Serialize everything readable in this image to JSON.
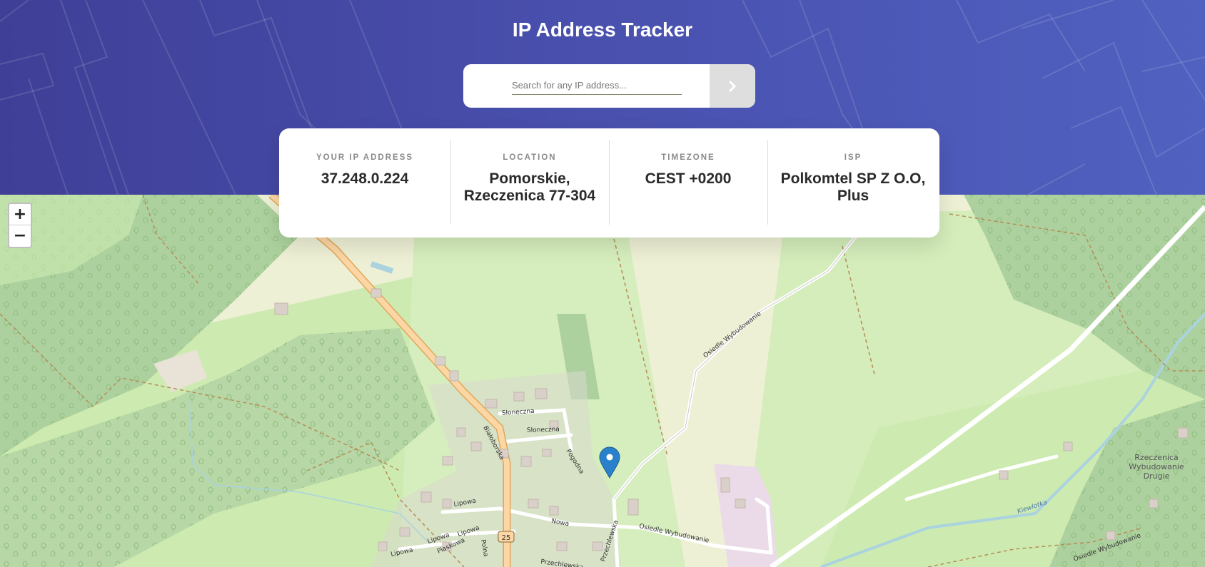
{
  "header": {
    "title": "IP Address Tracker"
  },
  "search": {
    "placeholder": "Search for any IP address...",
    "value": ""
  },
  "info": [
    {
      "label": "YOUR IP ADDRESS",
      "value": "37.248.0.224"
    },
    {
      "label": "LOCATION",
      "value": "Pomorskie,\nRzeczenica 77-304"
    },
    {
      "label": "TIMEZONE",
      "value": "CEST +0200"
    },
    {
      "label": "ISP",
      "value": "Polkomtel SP Z O.O,\nPlus"
    }
  ],
  "map": {
    "zoom_in": "+",
    "zoom_out": "−",
    "labels": {
      "slonecza1": "Słoneczna",
      "slonecza2": "Słoneczna",
      "bialoborska": "Białoborska",
      "pogodna": "Pogodna",
      "lipowa1": "Lipowa",
      "lipowa2": "Lipowa",
      "lipowa3": "Lipowa",
      "lipowa4": "Lipowa",
      "piaskowa": "Piaskowa",
      "polna": "Polna",
      "nowa": "Nowa",
      "osiedle1": "Osiedle Wybudowanie",
      "osiedle2": "Osiedle Wybudowanie",
      "osiedle3": "Osiedle Wybudowanie",
      "przechlewska1": "Przechlewska",
      "przechlewska2": "Przechlewska",
      "kiewlotka": "Kiewlotka",
      "rzeczenica1": "Rzeczenica",
      "rzeczenica2": "Wybudowanie",
      "rzeczenica3": "Drugie",
      "road_number": "25"
    }
  },
  "colors": {
    "header_gradient_start": "#3f3f97",
    "header_gradient_end": "#5061c0",
    "forest": "#add19e",
    "meadow": "#cdebb0",
    "farmland": "#eef0d5",
    "main_road": "#fcd6a4",
    "marker": "#2a81cb"
  }
}
